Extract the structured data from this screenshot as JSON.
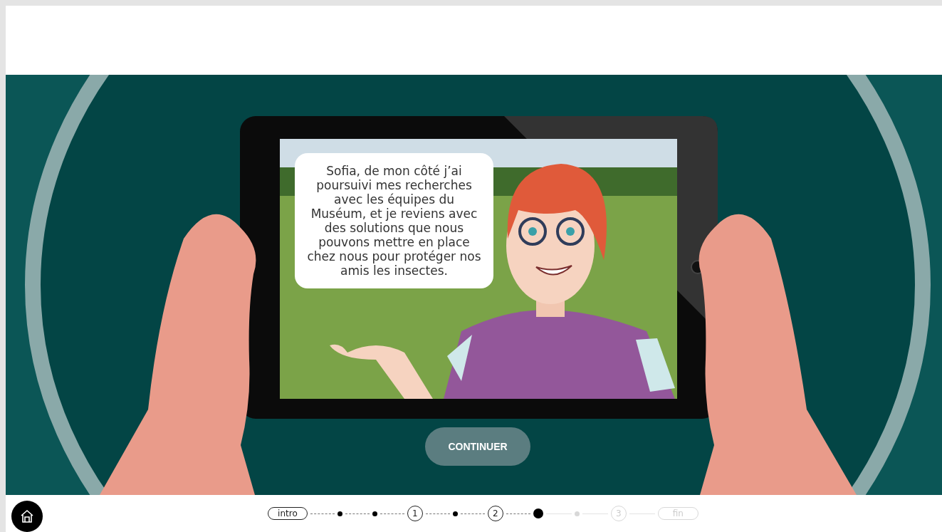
{
  "scene": {
    "dialogue": "Sofia, de mon côté j’ai poursuivi mes recherches avec les équipes du Muséum, et je reviens avec des solutions que nous pouvons mettre en place chez nous pour protéger nos amis les insectes.",
    "continue_button": "CONTINUER"
  },
  "progress": {
    "steps": [
      {
        "kind": "label",
        "text": "intro",
        "completed": true,
        "selected": false
      },
      {
        "kind": "dot",
        "completed": true,
        "selected": false
      },
      {
        "kind": "dot",
        "completed": true,
        "selected": false
      },
      {
        "kind": "number",
        "text": "1",
        "completed": true,
        "selected": false
      },
      {
        "kind": "dot",
        "completed": true,
        "selected": false
      },
      {
        "kind": "number",
        "text": "2",
        "completed": true,
        "selected": false
      },
      {
        "kind": "dot",
        "completed": false,
        "selected": true
      },
      {
        "kind": "dot",
        "completed": false,
        "selected": false
      },
      {
        "kind": "number",
        "text": "3",
        "completed": false,
        "selected": false
      },
      {
        "kind": "label",
        "text": "fin",
        "completed": false,
        "selected": false
      }
    ]
  }
}
